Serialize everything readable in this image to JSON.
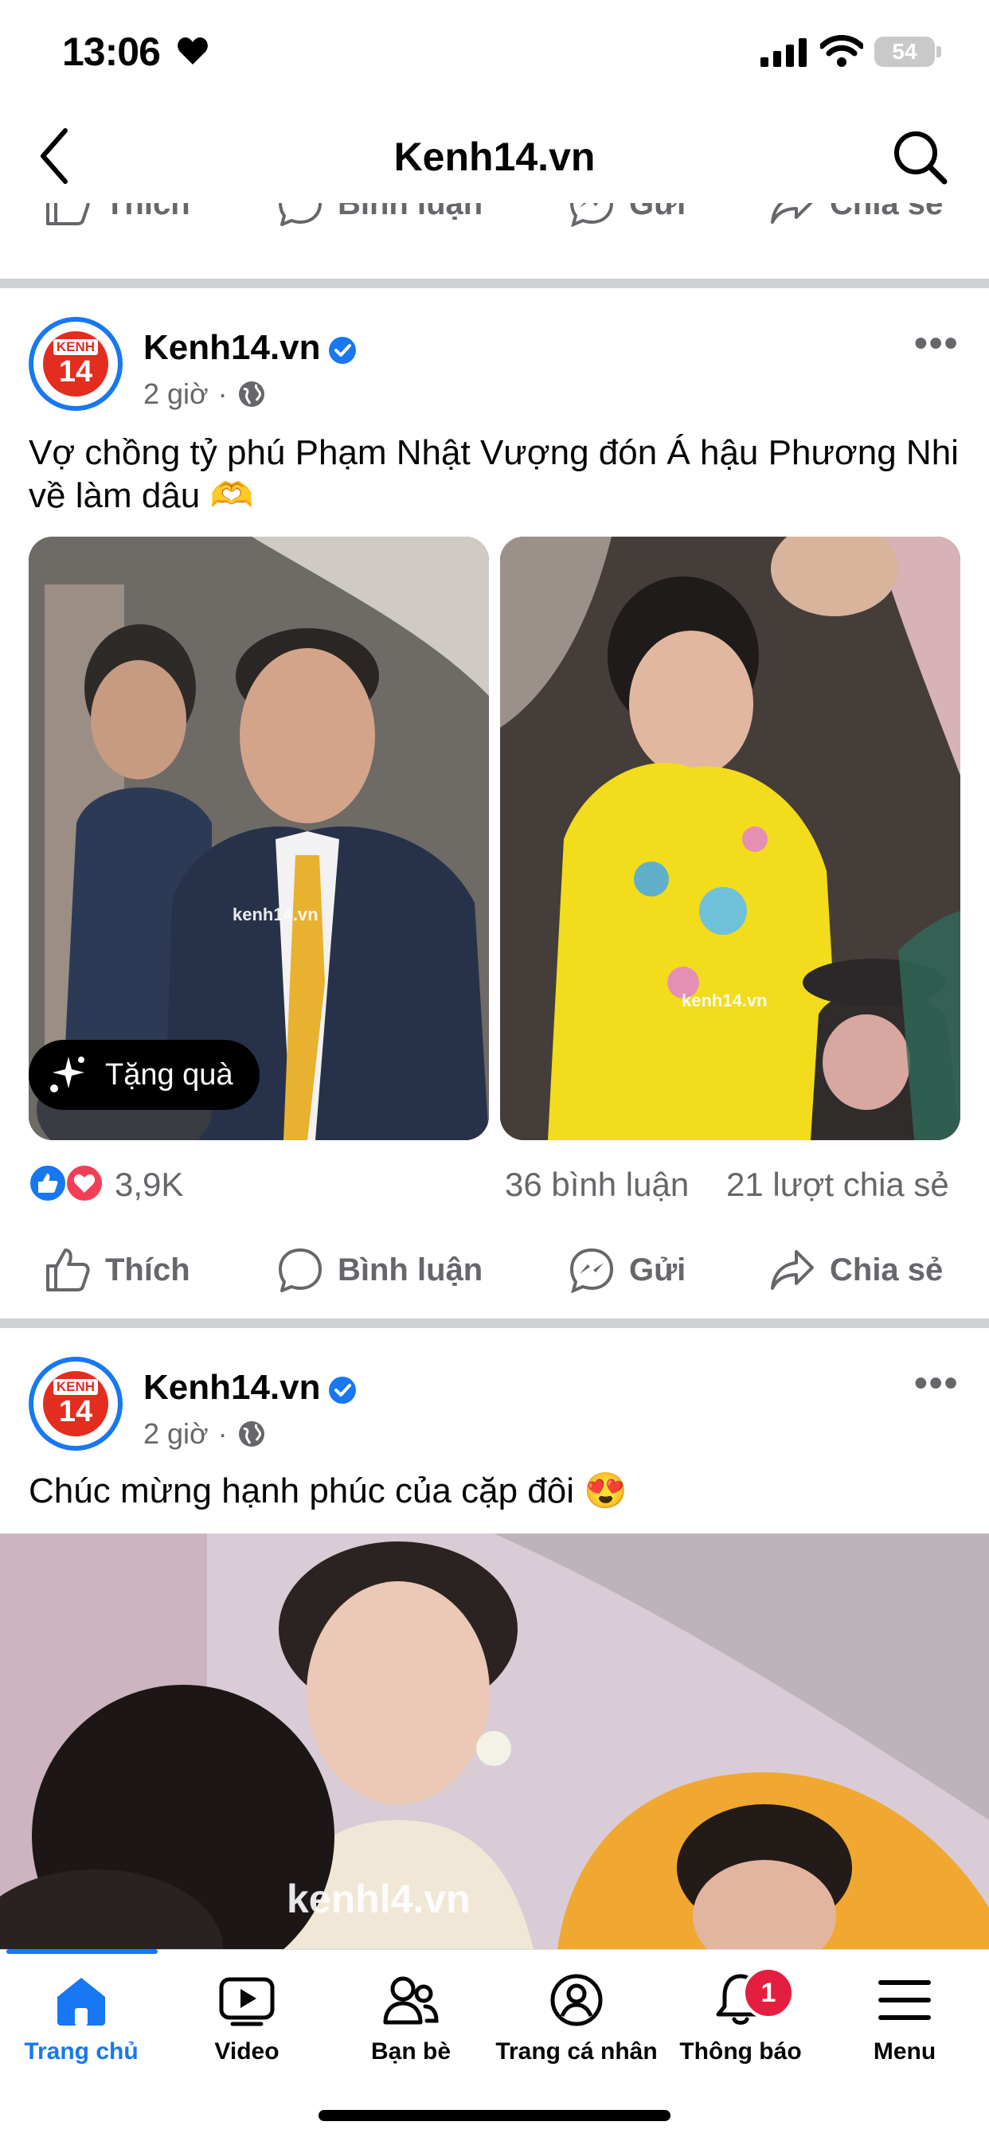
{
  "status_bar": {
    "time": "13:06",
    "battery": "54"
  },
  "header": {
    "title": "Kenh14.vn"
  },
  "actions": {
    "like": "Thích",
    "comment": "Bình luận",
    "send": "Gửi",
    "share": "Chia sẻ"
  },
  "posts": [
    {
      "page_name": "Kenh14.vn",
      "time": "2 giờ",
      "text": "Vợ chồng tỷ phú Phạm Nhật Vượng đón Á hậu Phương Nhi về làm dâu 🫶",
      "gift_label": "Tặng quà",
      "watermark": "kenh14.vn",
      "reactions": "3,9K",
      "comments": "36 bình luận",
      "shares": "21 lượt chia sẻ"
    },
    {
      "page_name": "Kenh14.vn",
      "time": "2 giờ",
      "text": "Chúc mừng hạnh phúc của cặp đôi 😍",
      "watermark": "kenhl4.vn"
    }
  ],
  "avatar_logo": {
    "top": "KENH",
    "bottom": "14"
  },
  "nav": [
    {
      "label": "Trang chủ",
      "icon": "home-icon"
    },
    {
      "label": "Video",
      "icon": "video-icon"
    },
    {
      "label": "Bạn bè",
      "icon": "friends-icon"
    },
    {
      "label": "Trang cá nhân",
      "icon": "profile-icon"
    },
    {
      "label": "Thông báo",
      "icon": "bell-icon",
      "badge": "1"
    },
    {
      "label": "Menu",
      "icon": "menu-icon"
    }
  ],
  "colors": {
    "accent": "#1877f2",
    "badge": "#e41e3f",
    "brand_red": "#e22d1f"
  }
}
